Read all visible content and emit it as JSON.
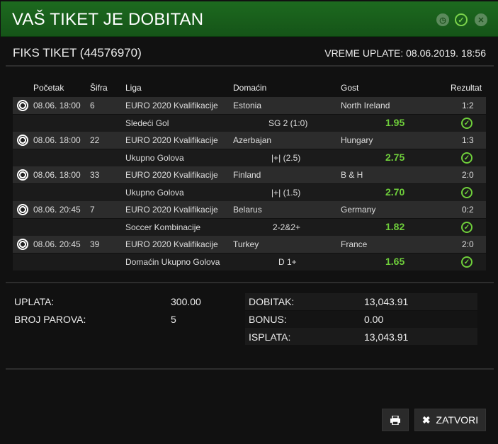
{
  "header": {
    "title": "VAŠ TIKET JE DOBITAN"
  },
  "ticket": {
    "title": "FIKS TIKET (44576970)",
    "pay_time": "VREME UPLATE: 08.06.2019. 18:56"
  },
  "columns": {
    "start": "Početak",
    "code": "Šifra",
    "league": "Liga",
    "home": "Domaćin",
    "away": "Gost",
    "result": "Rezultat"
  },
  "matches": [
    {
      "start": "08.06. 18:00",
      "code": "6",
      "league": "EURO 2020 Kvalifikacije",
      "home": "Estonia",
      "away": "North Ireland",
      "score": "1:2",
      "bet_type": "Sledeći Gol",
      "pick": "SG 2 (1:0)",
      "odds": "1.95"
    },
    {
      "start": "08.06. 18:00",
      "code": "22",
      "league": "EURO 2020 Kvalifikacije",
      "home": "Azerbajan",
      "away": "Hungary",
      "score": "1:3",
      "bet_type": "Ukupno Golova",
      "pick": "|+| (2.5)",
      "odds": "2.75"
    },
    {
      "start": "08.06. 18:00",
      "code": "33",
      "league": "EURO 2020 Kvalifikacije",
      "home": "Finland",
      "away": "B & H",
      "score": "2:0",
      "bet_type": "Ukupno Golova",
      "pick": "|+| (1.5)",
      "odds": "2.70"
    },
    {
      "start": "08.06. 20:45",
      "code": "7",
      "league": "EURO 2020 Kvalifikacije",
      "home": "Belarus",
      "away": "Germany",
      "score": "0:2",
      "bet_type": "Soccer Kombinacije",
      "pick": "2-2&2+",
      "odds": "1.82"
    },
    {
      "start": "08.06. 20:45",
      "code": "39",
      "league": "EURO 2020 Kvalifikacije",
      "home": "Turkey",
      "away": "France",
      "score": "2:0",
      "bet_type": "Domaćin Ukupno Golova",
      "pick": "D 1+",
      "odds": "1.65"
    }
  ],
  "summary": {
    "stake_label": "UPLATA:",
    "stake_value": "300.00",
    "pairs_label": "BROJ PAROVA:",
    "pairs_value": "5",
    "win_label": "DOBITAK:",
    "win_value": "13,043.91",
    "bonus_label": "BONUS:",
    "bonus_value": "0.00",
    "payout_label": "ISPLATA:",
    "payout_value": "13,043.91"
  },
  "buttons": {
    "close_label": "ZATVORI"
  },
  "icons": {
    "clock": "clock-icon",
    "check": "check-circle-icon",
    "close": "close-icon",
    "ball": "soccer-ball-icon",
    "won": "won-check-icon",
    "print": "printer-icon",
    "x": "x-icon"
  },
  "colors": {
    "header_green": "#1d6a1f",
    "odds_green": "#6fcf3b",
    "row_main": "#2c2c2c",
    "row_sub": "#1b1b1b"
  }
}
